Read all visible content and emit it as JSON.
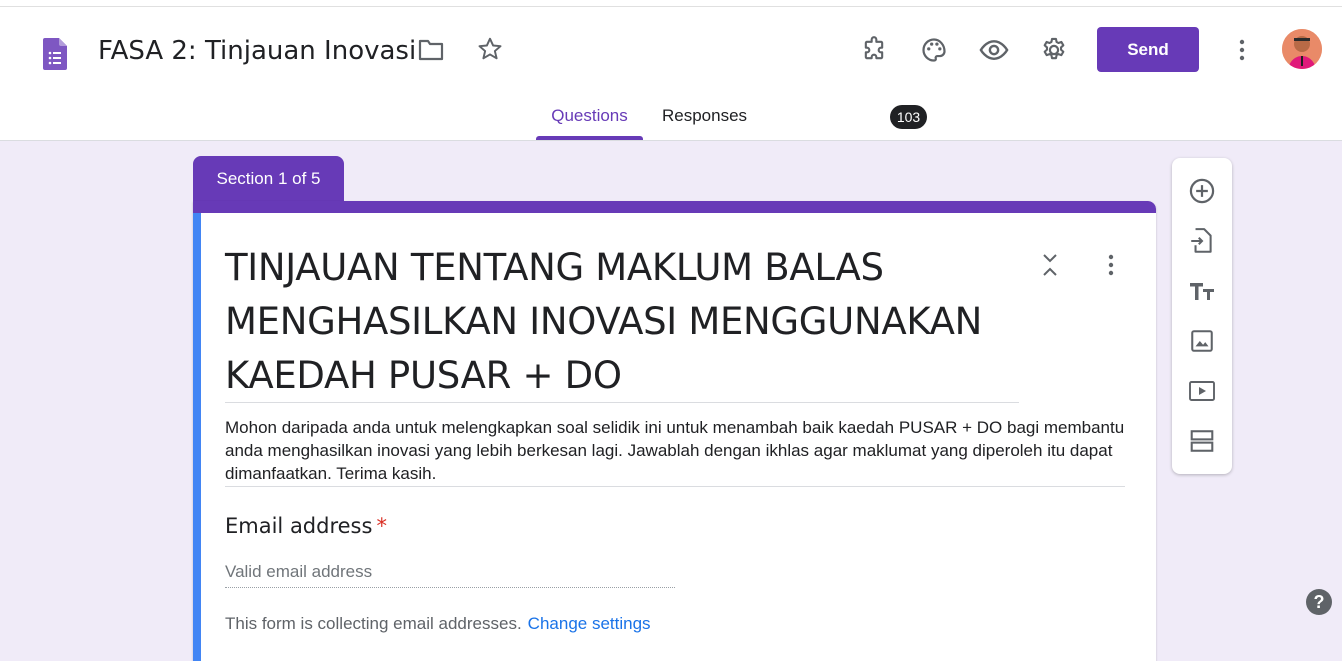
{
  "header": {
    "title": "FASA 2: Tinjauan Inovasi",
    "send_label": "Send",
    "icons": [
      "forms-logo-icon",
      "folder-icon",
      "star-icon",
      "addon-icon",
      "palette-icon",
      "preview-eye-icon",
      "settings-gear-icon",
      "more-vert-icon",
      "avatar"
    ]
  },
  "tabs": {
    "questions": "Questions",
    "responses": "Responses",
    "responses_count": "103"
  },
  "section": {
    "label": "Section 1 of 5"
  },
  "form": {
    "title": "TINJAUAN TENTANG MAKLUM BALAS MENGHASILKAN INOVASI MENGGUNAKAN KAEDAH PUSAR + DO",
    "description": "Mohon daripada anda untuk melengkapkan soal selidik ini untuk menambah baik kaedah PUSAR + DO bagi membantu anda menghasilkan inovasi yang lebih berkesan lagi. Jawablah dengan ikhlas agar maklumat yang diperoleh itu dapat dimanfaatkan. Terima kasih.",
    "email_label": "Email address",
    "required_mark": "*",
    "email_placeholder": "Valid email address",
    "collect_note": "This form is collecting email addresses.",
    "change_settings": "Change settings"
  },
  "toolbar": {
    "items": [
      "add-question-icon",
      "import-questions-icon",
      "add-title-icon",
      "add-image-icon",
      "add-video-icon",
      "add-section-icon"
    ]
  },
  "help_label": "?",
  "colors": {
    "accent": "#673ab7",
    "background": "#f0ebf8",
    "section_left_bar": "#4285f4",
    "link": "#1a73e8",
    "required": "#d93025"
  }
}
